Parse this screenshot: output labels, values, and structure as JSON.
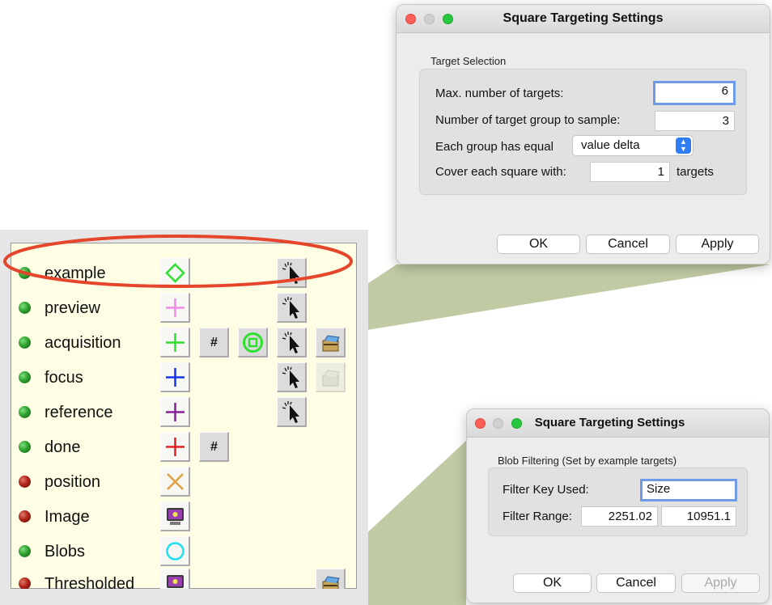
{
  "target_list": {
    "rows": [
      {
        "label": "example",
        "status": "green"
      },
      {
        "label": "preview",
        "status": "green"
      },
      {
        "label": "acquisition",
        "status": "green"
      },
      {
        "label": "focus",
        "status": "green"
      },
      {
        "label": "reference",
        "status": "green"
      },
      {
        "label": "done",
        "status": "green"
      },
      {
        "label": "position",
        "status": "red"
      },
      {
        "label": "Image",
        "status": "red"
      },
      {
        "label": "Blobs",
        "status": "green"
      },
      {
        "label": "Thresholded",
        "status": "red"
      }
    ],
    "hash_symbol": "#",
    "highlight_color": "#e5452a"
  },
  "dialog1": {
    "title": "Square Targeting Settings",
    "group_label": "Target Selection",
    "max_targets_label": "Max. number of targets:",
    "max_targets_value": "6",
    "group_count_label": "Number of target group to sample:",
    "group_count_value": "3",
    "each_group_label": "Each group has equal",
    "each_group_select": "value delta",
    "cover_label": "Cover each square with:",
    "cover_value": "1",
    "cover_unit": "targets",
    "ok": "OK",
    "cancel": "Cancel",
    "apply": "Apply"
  },
  "dialog2": {
    "title": "Square Targeting Settings",
    "group_label": "Blob Filtering (Set by example targets)",
    "filter_key_label": "Filter Key Used:",
    "filter_key_value": "Size",
    "filter_range_label": "Filter Range:",
    "filter_range_min": "2251.02",
    "filter_range_max": "10951.1",
    "ok": "OK",
    "cancel": "Cancel",
    "apply": "Apply"
  },
  "colors": {
    "panel_bg": "#fefee4",
    "callout": "#b5c193",
    "accent_blue": "#2f7cf6"
  }
}
